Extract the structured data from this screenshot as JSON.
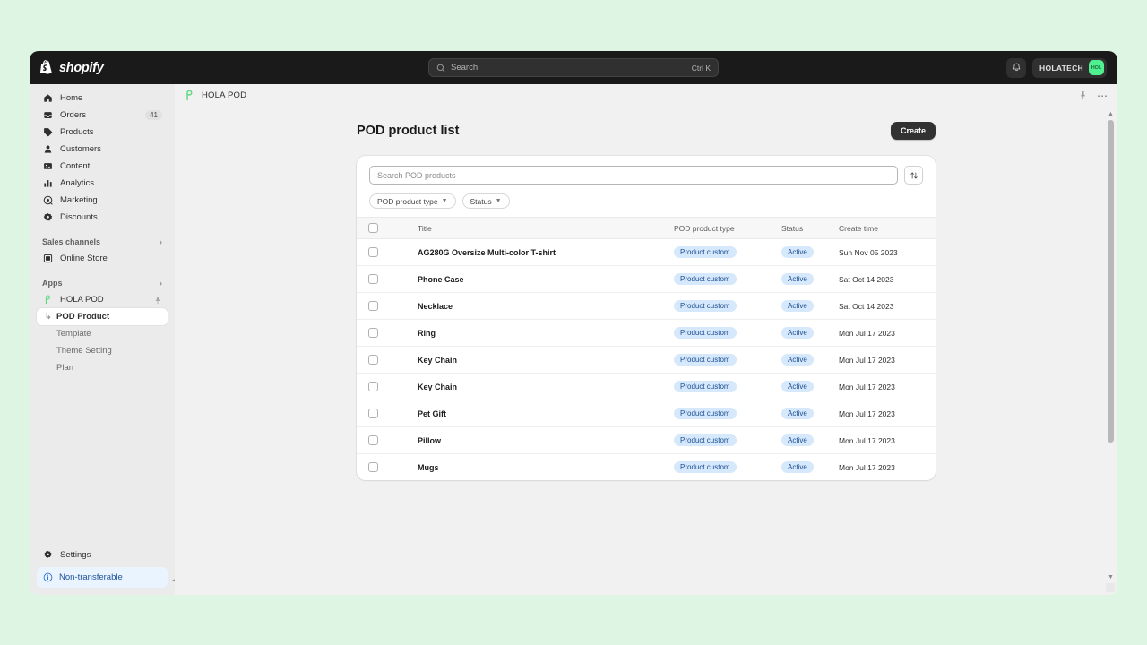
{
  "topbar": {
    "brand": "shopify",
    "search_placeholder": "Search",
    "search_shortcut": "Ctrl K",
    "notifications_icon": "bell-icon",
    "user_name": "HOLATECH",
    "avatar_initials": "HOL",
    "avatar_color": "#4ef08f"
  },
  "sidebar": {
    "items": [
      {
        "label": "Home",
        "icon": "home-icon",
        "badge": ""
      },
      {
        "label": "Orders",
        "icon": "orders-icon",
        "badge": "41"
      },
      {
        "label": "Products",
        "icon": "products-icon",
        "badge": ""
      },
      {
        "label": "Customers",
        "icon": "customers-icon",
        "badge": ""
      },
      {
        "label": "Content",
        "icon": "content-icon",
        "badge": ""
      },
      {
        "label": "Analytics",
        "icon": "analytics-icon",
        "badge": ""
      },
      {
        "label": "Marketing",
        "icon": "marketing-icon",
        "badge": ""
      },
      {
        "label": "Discounts",
        "icon": "discounts-icon",
        "badge": ""
      }
    ],
    "sales_channels_label": "Sales channels",
    "online_store_label": "Online Store",
    "apps_label": "Apps",
    "app_name": "HOLA POD",
    "app_children": [
      {
        "label": "POD Product",
        "active": true
      },
      {
        "label": "Template",
        "active": false
      },
      {
        "label": "Theme Setting",
        "active": false
      },
      {
        "label": "Plan",
        "active": false
      }
    ],
    "settings_label": "Settings",
    "notice_label": "Non-transferable",
    "notice_color": "#1f5199"
  },
  "breadcrumb": {
    "app_label": "HOLA POD",
    "pin_icon": "pin-icon",
    "more_icon": "more-options-icon"
  },
  "page": {
    "title": "POD product list",
    "create_label": "Create",
    "search_placeholder": "Search POD products",
    "search_value": "",
    "sort_icon": "sort-icon",
    "filters": [
      {
        "label": "POD product type"
      },
      {
        "label": "Status"
      }
    ],
    "columns": [
      "Title",
      "POD product type",
      "Status",
      "Create time"
    ],
    "rows": [
      {
        "title": "AG280G Oversize Multi-color T-shirt",
        "type": "Product custom",
        "status": "Active",
        "time": "Sun Nov 05 2023"
      },
      {
        "title": "Phone Case",
        "type": "Product custom",
        "status": "Active",
        "time": "Sat Oct 14 2023"
      },
      {
        "title": "Necklace",
        "type": "Product custom",
        "status": "Active",
        "time": "Sat Oct 14 2023"
      },
      {
        "title": "Ring",
        "type": "Product custom",
        "status": "Active",
        "time": "Mon Jul 17 2023"
      },
      {
        "title": "Key Chain",
        "type": "Product custom",
        "status": "Active",
        "time": "Mon Jul 17 2023"
      },
      {
        "title": "Key Chain",
        "type": "Product custom",
        "status": "Active",
        "time": "Mon Jul 17 2023"
      },
      {
        "title": "Pet Gift",
        "type": "Product custom",
        "status": "Active",
        "time": "Mon Jul 17 2023"
      },
      {
        "title": "Pillow",
        "type": "Product custom",
        "status": "Active",
        "time": "Mon Jul 17 2023"
      },
      {
        "title": "Mugs",
        "type": "Product custom",
        "status": "Active",
        "time": "Mon Jul 17 2023"
      }
    ],
    "badge_bg": "#d6e8fb",
    "badge_fg": "#1d4f91"
  }
}
